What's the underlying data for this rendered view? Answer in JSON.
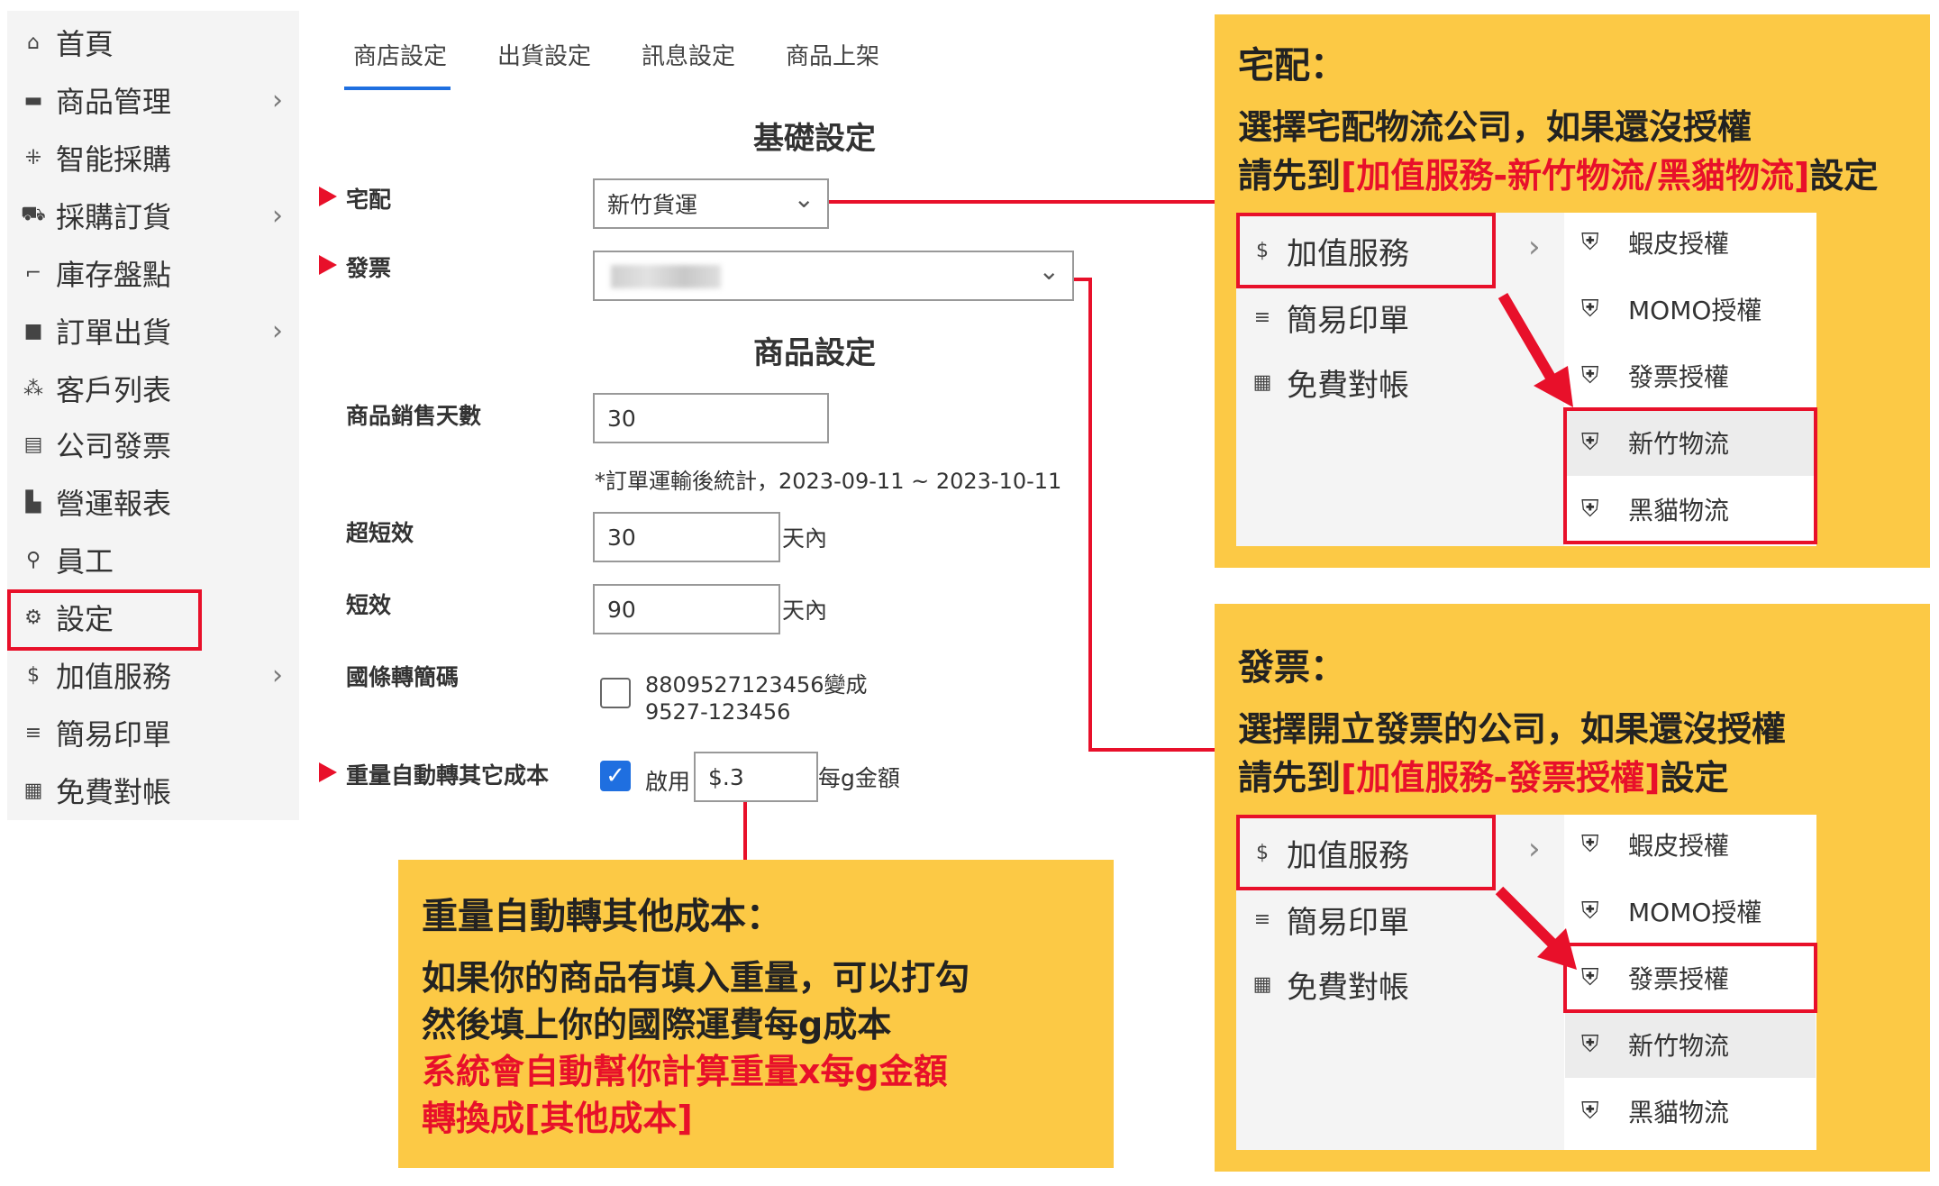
{
  "sidebar": {
    "items": [
      {
        "icon": "home-icon",
        "glyph": "⌂",
        "label": "首頁",
        "chevron": false
      },
      {
        "icon": "box-icon",
        "glyph": "▬",
        "label": "商品管理",
        "chevron": true
      },
      {
        "icon": "grid-icon",
        "glyph": "⁜",
        "label": "智能採購",
        "chevron": false
      },
      {
        "icon": "cart-icon",
        "glyph": "⛟",
        "label": "採購訂貨",
        "chevron": true
      },
      {
        "icon": "scanner-icon",
        "glyph": "⌐",
        "label": "庫存盤點",
        "chevron": false
      },
      {
        "icon": "bag-icon",
        "glyph": "■",
        "label": "訂單出貨",
        "chevron": true
      },
      {
        "icon": "users-icon",
        "glyph": "⁂",
        "label": "客戶列表",
        "chevron": false
      },
      {
        "icon": "invoice-icon",
        "glyph": "▤",
        "label": "公司發票",
        "chevron": false
      },
      {
        "icon": "bar-chart-icon",
        "glyph": "▙",
        "label": "營運報表",
        "chevron": false
      },
      {
        "icon": "user-icon",
        "glyph": "⚲",
        "label": "員工",
        "chevron": false
      },
      {
        "icon": "gear-icon",
        "glyph": "⚙",
        "label": "設定",
        "chevron": false
      },
      {
        "icon": "dollar-icon",
        "glyph": "$",
        "label": "加值服務",
        "chevron": true
      },
      {
        "icon": "menu-icon",
        "glyph": "≡",
        "label": "簡易印單",
        "chevron": false
      },
      {
        "icon": "calculator-icon",
        "glyph": "▦",
        "label": "免費對帳",
        "chevron": false
      }
    ],
    "chevron": "›"
  },
  "tabs": [
    "商店設定",
    "出貨設定",
    "訊息設定",
    "商品上架"
  ],
  "form": {
    "basic_title": "基礎設定",
    "delivery_label": "宅配",
    "delivery_value": "新竹貨運",
    "invoice_label": "發票",
    "invoice_value": "",
    "product_title": "商品設定",
    "sale_days_label": "商品銷售天數",
    "sale_days_value": "30",
    "sale_days_note": "*訂單運輸後統計，2023-09-11 ~ 2023-10-11",
    "ultra_short_label": "超短效",
    "ultra_short_value": "30",
    "short_label": "短效",
    "short_value": "90",
    "unit_days": "天內",
    "barcode_label": "國條轉簡碼",
    "barcode_line1": "8809527123456變成",
    "barcode_line2": "9527-123456",
    "weight_label": "重量自動轉其它成本",
    "enable_label": "啟用",
    "weight_value": "$.3",
    "weight_unit": "每g金額",
    "dropdown_chevron": "⌄",
    "check_mark": "✓"
  },
  "callout_delivery": {
    "title": "宅配：",
    "line1": "選擇宅配物流公司，如果還沒授權",
    "line2_prefix": "請先到",
    "line2_red": "[加值服務-新竹物流/黑貓物流]",
    "line2_suffix": "設定"
  },
  "callout_invoice": {
    "title": "發票：",
    "line1": "選擇開立發票的公司，如果還沒授權",
    "line2_prefix": "請先到",
    "line2_red": "[加值服務-發票授權]",
    "line2_suffix": "設定"
  },
  "callout_weight": {
    "title": "重量自動轉其他成本：",
    "line1": "如果你的商品有填入重量，可以打勾",
    "line2": "然後填上你的國際運費每g成本",
    "line3_red": "系統會自動幫你計算重量x每g金額",
    "line4_red": "轉換成[其他成本]"
  },
  "mini_menu": {
    "left": [
      {
        "glyph": "$",
        "label": "加值服務"
      },
      {
        "glyph": "≡",
        "label": "簡易印單"
      },
      {
        "glyph": "▦",
        "label": "免費對帳"
      }
    ],
    "chevron": "›",
    "right": [
      "蝦皮授權",
      "MOMO授權",
      "發票授權",
      "新竹物流",
      "黑貓物流"
    ],
    "shield": "⛨"
  },
  "colors": {
    "accent": "#1f6fe0",
    "highlight": "#e8102a",
    "callout": "#fcc945"
  }
}
